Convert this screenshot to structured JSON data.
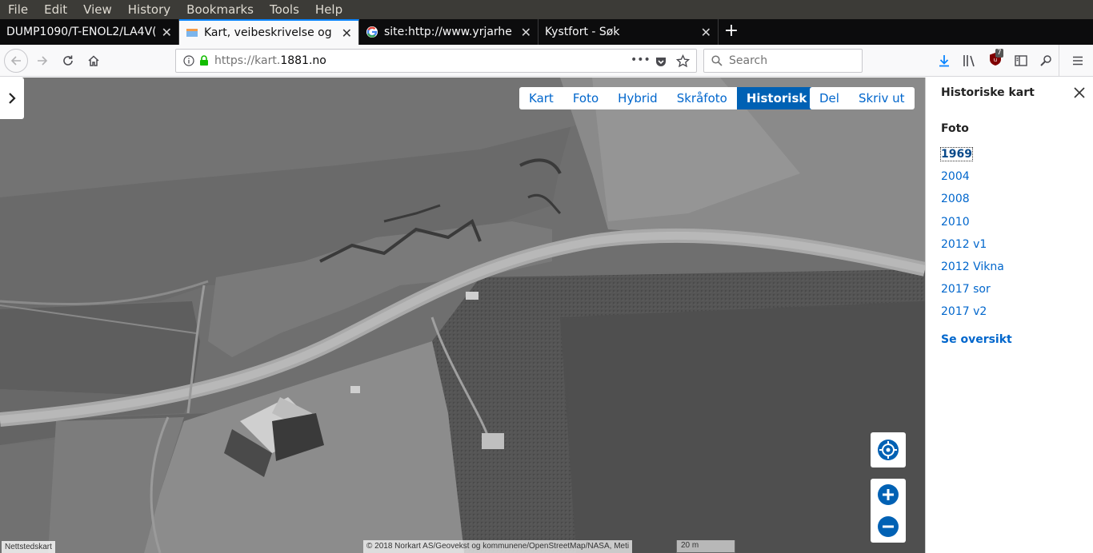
{
  "menubar": [
    "File",
    "Edit",
    "View",
    "History",
    "Bookmarks",
    "Tools",
    "Help"
  ],
  "tabs": [
    {
      "title": "DUMP1090/T-ENOL2/LA4V(",
      "active": false
    },
    {
      "title": "Kart, veibeskrivelse og k",
      "active": true
    },
    {
      "title": "site:http://www.yrjarhe",
      "active": false
    },
    {
      "title": "Kystfort - Søk",
      "active": false
    }
  ],
  "navbar": {
    "url_prefix": "https://kart.",
    "url_domain": "1881.no",
    "search_placeholder": "Search",
    "ublock_badge": "7"
  },
  "map": {
    "types": [
      "Kart",
      "Foto",
      "Hybrid",
      "Skråfoto",
      "Historisk"
    ],
    "active_type": "Historisk",
    "share_actions": [
      "Del",
      "Skriv ut"
    ],
    "attribution": "© 2018 Norkart AS/Geovekst og kommunene/OpenStreetMap/NASA, Meti",
    "scale_label": "20 m",
    "nettstedskart": "Nettstedskart"
  },
  "panel": {
    "title": "Historiske kart",
    "section": "Foto",
    "years": [
      "1969",
      "2004",
      "2008",
      "2010",
      "2012 v1",
      "2012 Vikna",
      "2017 sor",
      "2017 v2"
    ],
    "selected_year": "1969",
    "overview_link": "Se oversikt"
  },
  "colors": {
    "accent": "#0061b4",
    "link": "#0066cc",
    "firefox_blue": "#0a84ff"
  }
}
